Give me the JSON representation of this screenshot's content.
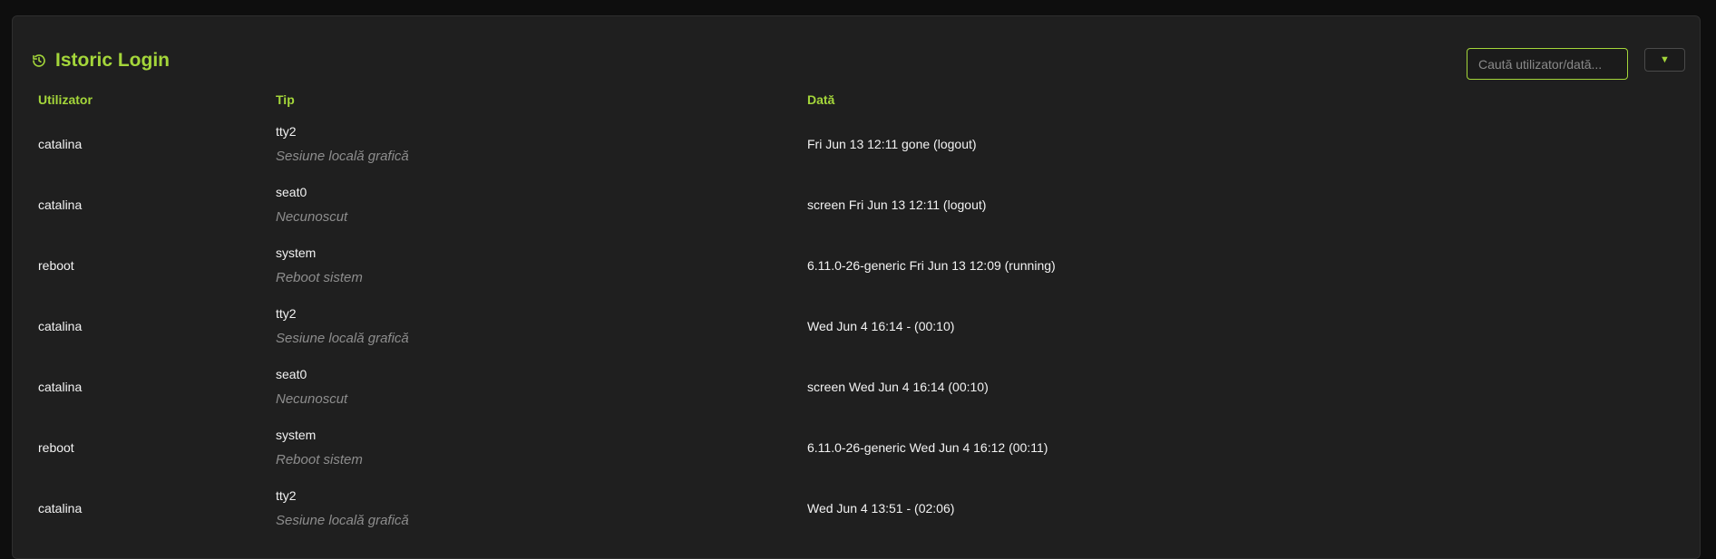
{
  "section": {
    "title": "Istoric Login",
    "icon": "history-icon",
    "accent_color": "#a4d63a"
  },
  "search": {
    "placeholder": "Caută utilizator/dată...",
    "value": ""
  },
  "filter": {
    "label": "▼",
    "icon": "chevron-down-icon"
  },
  "table": {
    "columns": [
      "Utilizator",
      "Tip",
      "Dată"
    ],
    "rows": [
      {
        "user": "catalina",
        "type": "tty2",
        "type_desc": "Sesiune locală grafică",
        "date": "Fri Jun 13 12:11 gone (logout)"
      },
      {
        "user": "catalina",
        "type": "seat0",
        "type_desc": "Necunoscut",
        "date": "screen Fri Jun 13 12:11 (logout)"
      },
      {
        "user": "reboot",
        "type": "system",
        "type_desc": "Reboot sistem",
        "date": "6.11.0-26-generic Fri Jun 13 12:09 (running)"
      },
      {
        "user": "catalina",
        "type": "tty2",
        "type_desc": "Sesiune locală grafică",
        "date": "Wed Jun 4 16:14 - (00:10)"
      },
      {
        "user": "catalina",
        "type": "seat0",
        "type_desc": "Necunoscut",
        "date": "screen Wed Jun 4 16:14 (00:10)"
      },
      {
        "user": "reboot",
        "type": "system",
        "type_desc": "Reboot sistem",
        "date": "6.11.0-26-generic Wed Jun 4 16:12 (00:11)"
      },
      {
        "user": "catalina",
        "type": "tty2",
        "type_desc": "Sesiune locală grafică",
        "date": "Wed Jun 4 13:51 - (02:06)"
      }
    ]
  }
}
